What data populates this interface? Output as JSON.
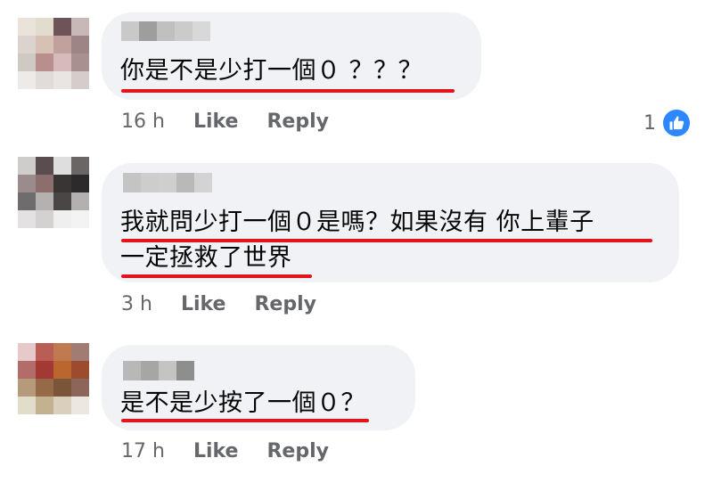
{
  "comments": [
    {
      "text_lines": [
        "你是不是少打一個０ ？？？"
      ],
      "time": "16 h",
      "like_label": "Like",
      "reply_label": "Reply",
      "reaction_count": "1",
      "reaction_icon": "like-thumb-icon",
      "avatar_colors": [
        "#e9e3d9",
        "#e2dccf",
        "#6e5358",
        "#c8b8b7",
        "#dcd3cf",
        "#d7c0b4",
        "#c0a19d",
        "#9e8484",
        "#cfc9c3",
        "#b98f8e",
        "#d5bcbb",
        "#a8908f",
        "#eeeae7",
        "#e1dcd9",
        "#e9e5e3",
        "#d4cdcc"
      ],
      "name_colors": [
        "#c9c9c9",
        "#9e9e9e",
        "#c0c0c0",
        "#cbcbcb",
        "#d8d8d8"
      ]
    },
    {
      "text_lines": [
        "我就問少打一個０是嗎？如果沒有 你上輩子",
        "一定拯救了世界"
      ],
      "time": "3 h",
      "like_label": "Like",
      "reply_label": "Reply",
      "avatar_colors": [
        "#cfcccc",
        "#5a4d4f",
        "#dedede",
        "#6b6666",
        "#9a8c8d",
        "#8c6e6c",
        "#3a3535",
        "#2c2a2a",
        "#6e6c6c",
        "#b5b1b0",
        "#4a4646",
        "#b3b0af",
        "#e3e1e1",
        "#d4d1d1",
        "#efefef",
        "#f4f3f3"
      ],
      "name_colors": [
        "#c4c4c4",
        "#cdcdcd",
        "#cfcfcf",
        "#b9b9b9",
        "#d3d3d3"
      ]
    },
    {
      "text_lines": [
        "是不是少按了一個０？"
      ],
      "time": "17 h",
      "like_label": "Like",
      "reply_label": "Reply",
      "avatar_colors": [
        "#e8c9c9",
        "#b85e55",
        "#c07a52",
        "#a17c72",
        "#b26c6a",
        "#a23a33",
        "#b9672f",
        "#9c4b2f",
        "#b69a7c",
        "#946a48",
        "#7a5538",
        "#8c6658",
        "#e2dccb",
        "#c3b28f",
        "#d9cfbc",
        "#ece8df"
      ],
      "name_colors": [
        "#b8b8b8",
        "#a6a6a6",
        "#c4c4c4",
        "#8e8e8e"
      ]
    }
  ]
}
